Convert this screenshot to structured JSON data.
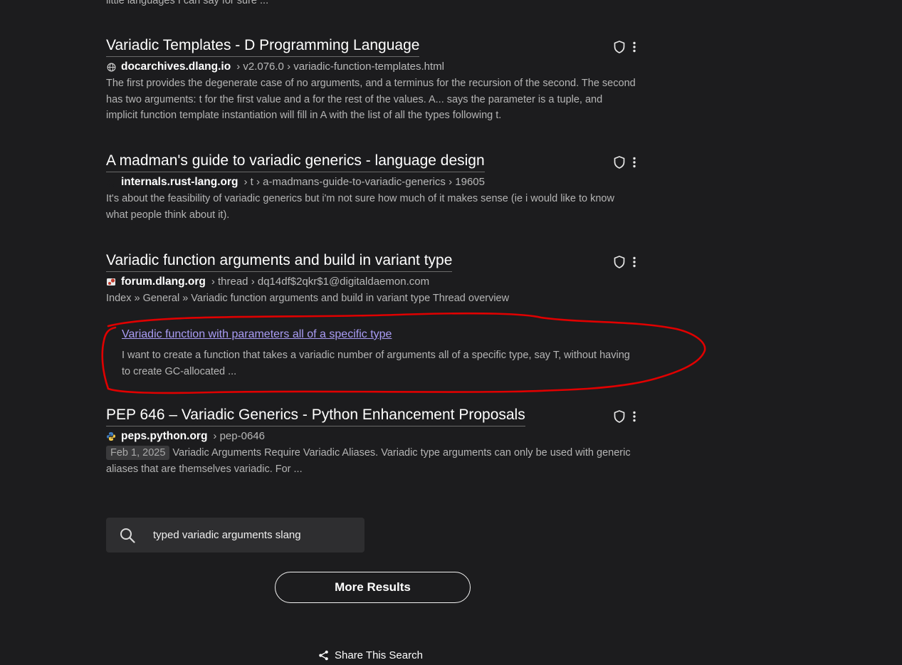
{
  "top_snippet": "little languages I can say for sure ...",
  "results": [
    {
      "title": "Variadic Templates - D Programming Language",
      "domain": "docarchives.dlang.io",
      "path": "› v2.076.0 › variadic-function-templates.html",
      "favicon": "globe-icon",
      "snippet": "The first provides the degenerate case of no arguments, and a terminus for the recursion of the second. The second has two arguments: t for the first value and a for the rest of the values. A... says the parameter is a tuple, and implicit function template instantiation will fill in A with the list of all the types following t."
    },
    {
      "title": "A madman's guide to variadic generics - language design",
      "domain": "internals.rust-lang.org",
      "path": "› t › a-madmans-guide-to-variadic-generics › 19605",
      "favicon": "rust-favicon",
      "snippet": "It's about the feasibility of variadic generics but i'm not sure how much of it makes sense (ie i would like to know what people think about it)."
    },
    {
      "title": "Variadic function arguments and build in variant type",
      "domain": "forum.dlang.org",
      "path": "› thread › dq14df$2qkr$1@digitaldaemon.com",
      "favicon": "dlang-favicon",
      "snippet": "Index » General » Variadic function arguments and build in variant type Thread overview",
      "sitelink": {
        "title": "Variadic function with parameters all of a specific type",
        "snippet": "I want to create a function that takes a variadic number of arguments all of a specific type, say T, without having to create GC-allocated ..."
      }
    },
    {
      "title": "PEP 646 – Variadic Generics - Python Enhancement Proposals",
      "domain": "peps.python.org",
      "path": "› pep-0646",
      "favicon": "python-favicon",
      "date": "Feb 1, 2025",
      "snippet": "Variadic Arguments Require Variadic Aliases. Variadic type arguments can only be used with generic aliases that are themselves variadic. For ..."
    }
  ],
  "search": {
    "value": "typed variadic arguments slang",
    "icon": "search-icon"
  },
  "more_results_label": "More Results",
  "share_label": "Share This Search",
  "colors": {
    "background": "#1c1c1e",
    "link_visited": "#a99cf4",
    "annotation": "#e00000"
  }
}
